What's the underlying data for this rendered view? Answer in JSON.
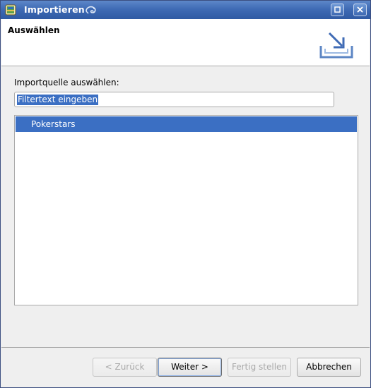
{
  "window": {
    "title": "Importieren"
  },
  "header": {
    "title": "Auswählen"
  },
  "source": {
    "label": "Importquelle auswählen:",
    "filter_value": "Filtertext eingeben"
  },
  "list": {
    "items": [
      {
        "label": "Pokerstars",
        "selected": true
      }
    ]
  },
  "buttons": {
    "back": "< Zurück",
    "next": "Weiter >",
    "finish": "Fertig stellen",
    "cancel": "Abbrechen"
  },
  "colors": {
    "titlebar": "#3f6bb5",
    "selection": "#3b6fc3",
    "window_bg": "#efefef"
  }
}
